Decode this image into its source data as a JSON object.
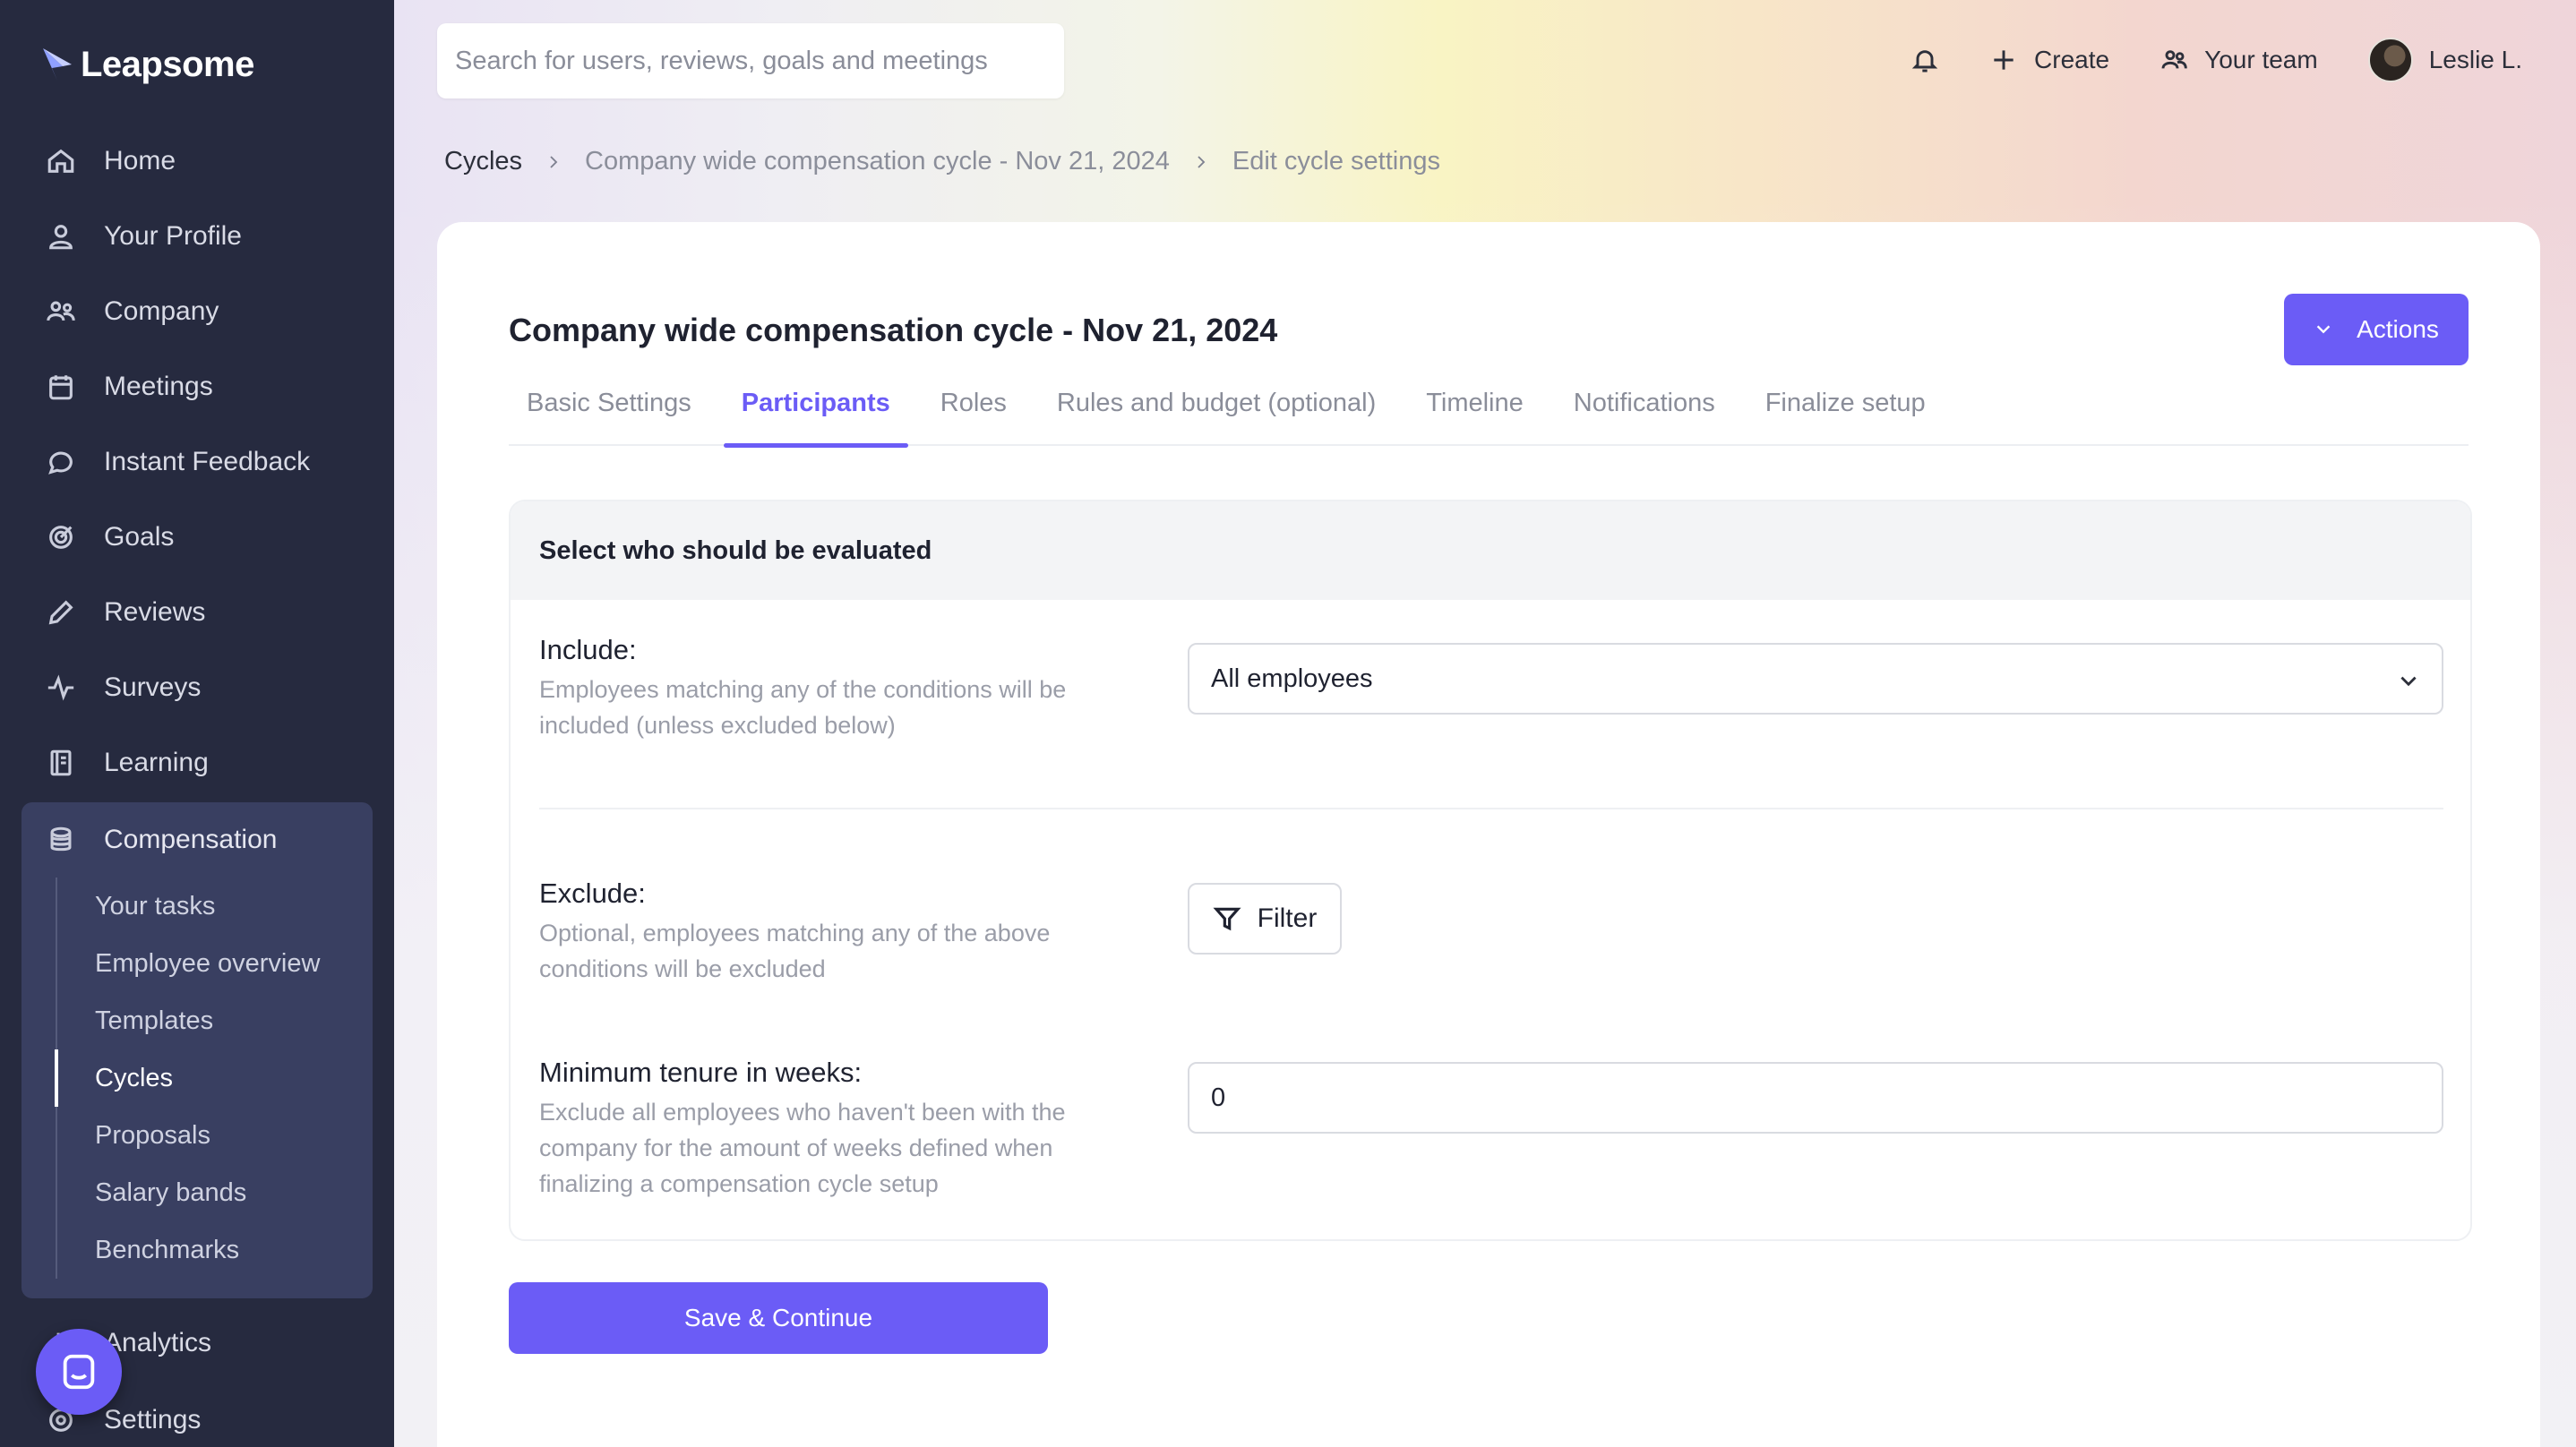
{
  "app": {
    "name": "Leapsome"
  },
  "sidebar": {
    "items": [
      {
        "label": "Home",
        "icon": "home-icon"
      },
      {
        "label": "Your Profile",
        "icon": "user-icon"
      },
      {
        "label": "Company",
        "icon": "users-icon"
      },
      {
        "label": "Meetings",
        "icon": "calendar-icon"
      },
      {
        "label": "Instant Feedback",
        "icon": "chat-icon"
      },
      {
        "label": "Goals",
        "icon": "target-icon"
      },
      {
        "label": "Reviews",
        "icon": "pencil-icon"
      },
      {
        "label": "Surveys",
        "icon": "pulse-icon"
      },
      {
        "label": "Learning",
        "icon": "book-icon"
      }
    ],
    "compensation": {
      "label": "Compensation",
      "icon": "coins-icon",
      "subitems": [
        "Your tasks",
        "Employee overview",
        "Templates",
        "Cycles",
        "Proposals",
        "Salary bands",
        "Benchmarks"
      ],
      "active": "Cycles"
    },
    "after": [
      "Analytics",
      "Settings"
    ]
  },
  "topbar": {
    "search_placeholder": "Search for users, reviews, goals and meetings",
    "create_label": "Create",
    "team_label": "Your team",
    "user_name": "Leslie L."
  },
  "breadcrumb": [
    "Cycles",
    "Company wide compensation cycle - Nov 21, 2024",
    "Edit cycle settings"
  ],
  "card": {
    "title": "Company wide compensation cycle - Nov 21, 2024",
    "actions_label": "Actions",
    "tabs": [
      "Basic Settings",
      "Participants",
      "Roles",
      "Rules and budget (optional)",
      "Timeline",
      "Notifications",
      "Finalize setup"
    ],
    "active_tab": "Participants"
  },
  "panel": {
    "heading": "Select who should be evaluated",
    "include": {
      "label": "Include:",
      "help": "Employees matching any of the conditions will be included (unless excluded below)",
      "value": "All employees"
    },
    "exclude": {
      "label": "Exclude:",
      "help": "Optional, employees matching any of the above conditions will be excluded",
      "filter_label": "Filter"
    },
    "tenure": {
      "label": "Minimum tenure in weeks:",
      "help": "Exclude all employees who haven't been with the company for the amount of weeks defined when finalizing a compensation cycle setup",
      "value": "0"
    }
  },
  "save_label": "Save & Continue",
  "colors": {
    "accent": "#6b5cf6",
    "sidebar": "#262a3f",
    "sidebar_group": "#393f61"
  }
}
